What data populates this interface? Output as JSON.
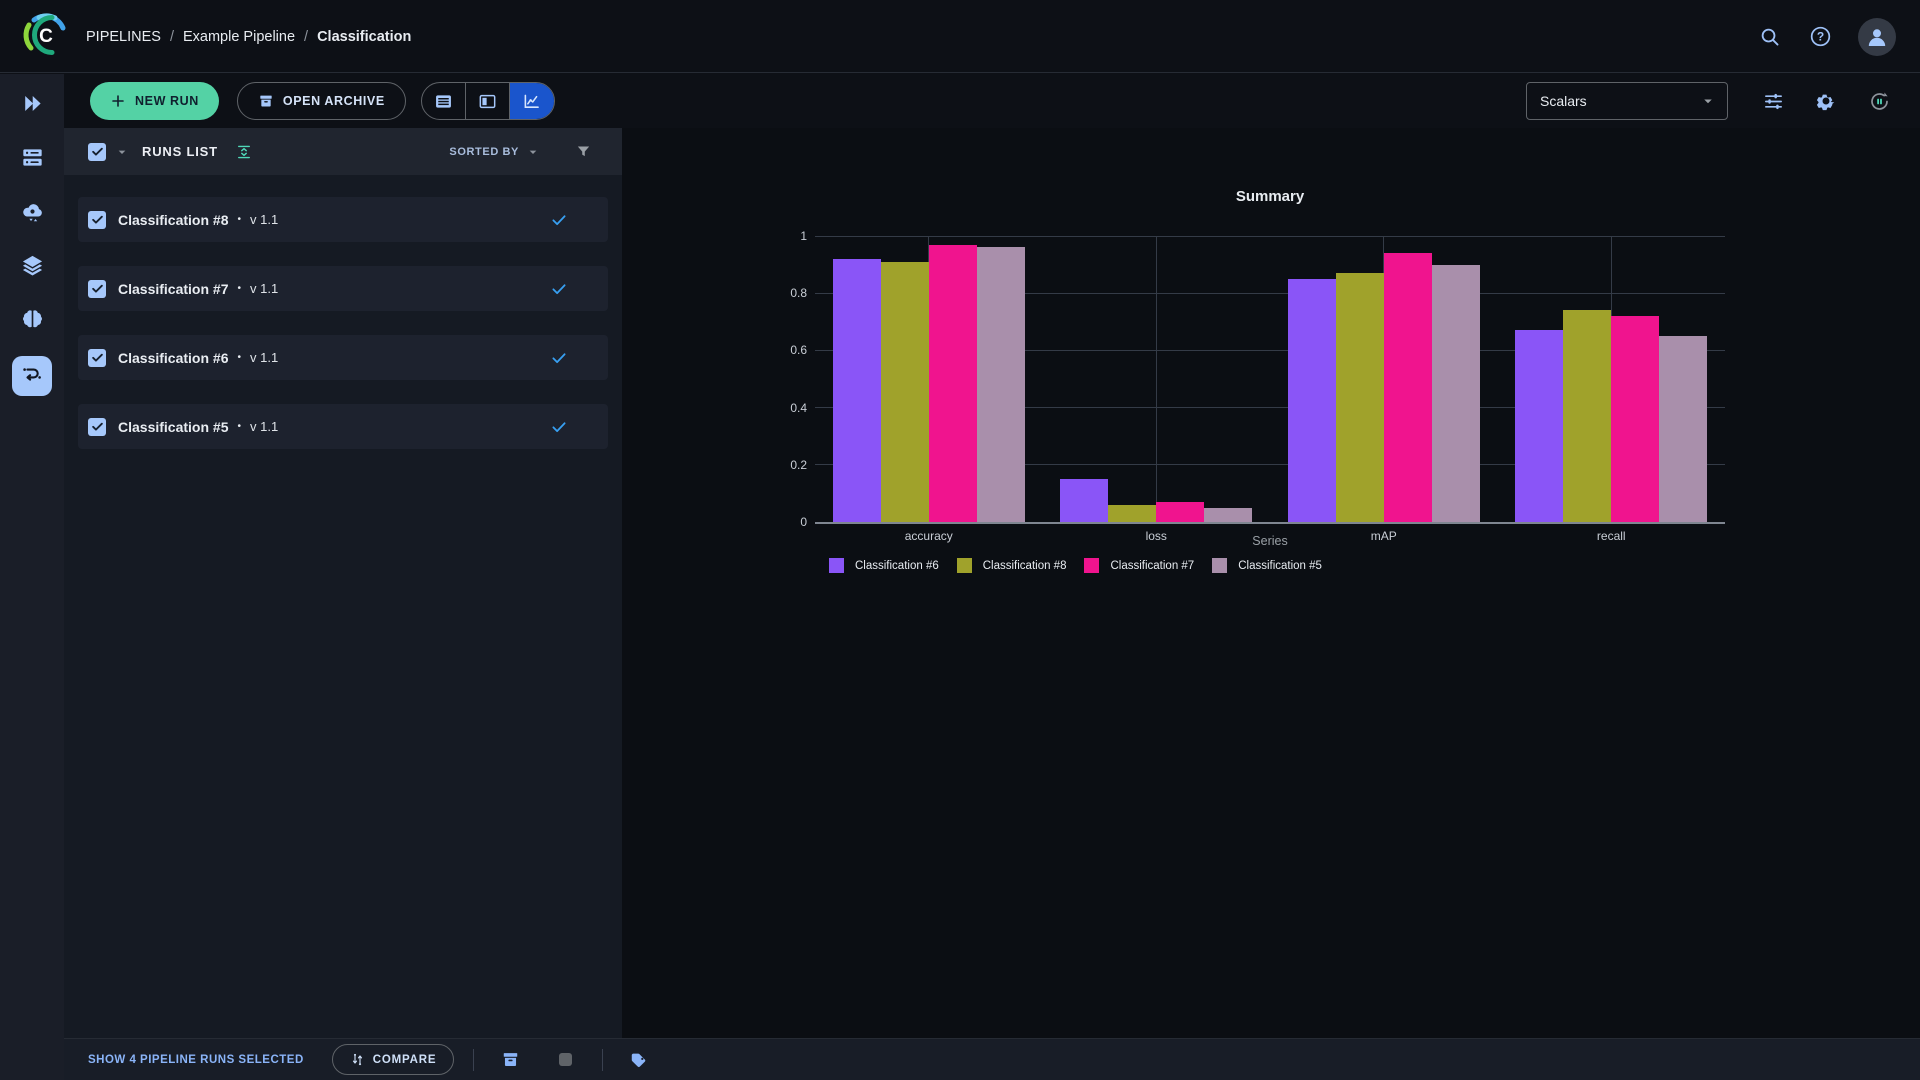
{
  "colors": {
    "accent_blue": "#9ec1f7",
    "active_segment_blue": "#1a55cc",
    "mint_green": "#54d2a5",
    "teal": "#4fd8b8",
    "status_check_blue": "#38a0f2",
    "checkbox_blue": "#a6c8fb"
  },
  "topbar": {
    "separator": "/",
    "breadcrumb": [
      {
        "label": "PIPELINES"
      },
      {
        "label": "Example Pipeline"
      },
      {
        "label": "Classification"
      }
    ]
  },
  "toolbar": {
    "new_run": "NEW RUN",
    "open_archive": "OPEN ARCHIVE",
    "metric_select": "Scalars"
  },
  "runs_panel": {
    "title": "RUNS LIST",
    "sorted_by": "SORTED BY",
    "bullet": "•",
    "items": [
      {
        "name": "Classification #8",
        "version": "v 1.1",
        "checked": true,
        "status": "completed"
      },
      {
        "name": "Classification #7",
        "version": "v 1.1",
        "checked": true,
        "status": "completed"
      },
      {
        "name": "Classification #6",
        "version": "v 1.1",
        "checked": true,
        "status": "completed"
      },
      {
        "name": "Classification #5",
        "version": "v 1.1",
        "checked": true,
        "status": "completed"
      }
    ]
  },
  "chart_data": {
    "type": "bar",
    "title": "Summary",
    "categories": [
      "accuracy",
      "loss",
      "mAP",
      "recall"
    ],
    "series": [
      {
        "name": "Classification #6",
        "color": "#8a55f7",
        "values": [
          0.92,
          0.15,
          0.85,
          0.67
        ]
      },
      {
        "name": "Classification #8",
        "color": "#a0a22b",
        "values": [
          0.91,
          0.06,
          0.87,
          0.74
        ]
      },
      {
        "name": "Classification #7",
        "color": "#f0148e",
        "values": [
          0.97,
          0.07,
          0.94,
          0.72
        ]
      },
      {
        "name": "Classification #5",
        "color": "#a98fab",
        "values": [
          0.96,
          0.05,
          0.9,
          0.65
        ]
      }
    ],
    "legend_title": "Series",
    "xlabel": "",
    "ylabel": "",
    "ylim": [
      0,
      1
    ],
    "yticks": [
      0,
      0.2,
      0.4,
      0.6,
      0.8,
      1
    ],
    "grid": true,
    "legend_position": "bottom"
  },
  "bottombar": {
    "selected_text": "SHOW 4 PIPELINE RUNS SELECTED",
    "compare": "COMPARE"
  }
}
